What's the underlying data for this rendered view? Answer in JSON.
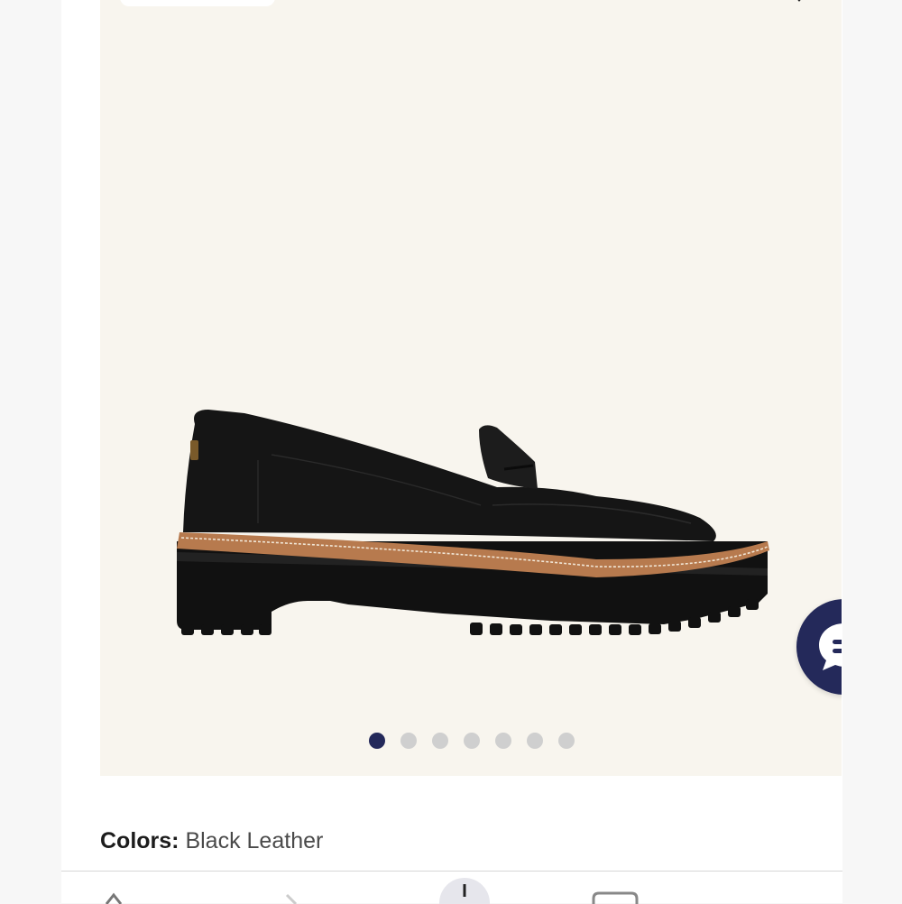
{
  "product": {
    "image_name": "black-leather-penny-loafer-side-view",
    "colors_label": "Colors:",
    "color_value": "Black Leather"
  },
  "gallery": {
    "dot_count": 7,
    "active_index": 0,
    "active_color": "#24295a",
    "inactive_color": "#cfcfcf"
  },
  "chat": {
    "icon": "chat-bubble-icon",
    "color": "#24295a"
  },
  "bottom_nav": {
    "icons": [
      "back-arrow-icon",
      "forward-arrow-icon",
      "share-icon",
      "tabs-icon"
    ]
  }
}
